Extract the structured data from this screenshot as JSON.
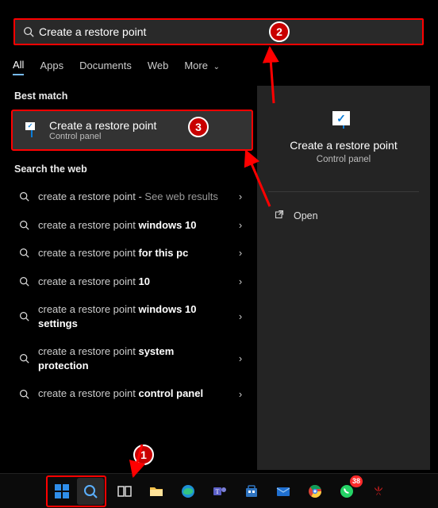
{
  "search": {
    "query": "Create a restore point"
  },
  "tabs": [
    {
      "label": "All",
      "active": true
    },
    {
      "label": "Apps",
      "active": false
    },
    {
      "label": "Documents",
      "active": false
    },
    {
      "label": "Web",
      "active": false
    },
    {
      "label": "More",
      "active": false,
      "hasChevron": true
    }
  ],
  "sections": {
    "bestMatch": "Best match",
    "searchWeb": "Search the web"
  },
  "bestMatch": {
    "title": "Create a restore point",
    "subtitle": "Control panel"
  },
  "web": [
    {
      "prefix": "create a restore point",
      "bold": "",
      "sub": "See web results"
    },
    {
      "prefix": "create a restore point ",
      "bold": "windows 10",
      "sub": ""
    },
    {
      "prefix": "create a restore point ",
      "bold": "for this pc",
      "sub": ""
    },
    {
      "prefix": "create a restore point ",
      "bold": "10",
      "sub": ""
    },
    {
      "prefix": "create a restore point ",
      "bold": "windows 10 settings",
      "sub": ""
    },
    {
      "prefix": "create a restore point ",
      "bold": "system protection",
      "sub": ""
    },
    {
      "prefix": "create a restore point ",
      "bold": "control panel",
      "sub": ""
    }
  ],
  "rightPanel": {
    "title": "Create a restore point",
    "subtitle": "Control panel",
    "open": "Open"
  },
  "annotations": {
    "step1": "1",
    "step2": "2",
    "step3": "3"
  },
  "taskbar": {
    "items": [
      "start",
      "search",
      "taskview",
      "explorer",
      "edge",
      "teams",
      "store",
      "mail",
      "chrome",
      "whatsapp",
      "huawei"
    ],
    "whatsappBadge": "38"
  }
}
